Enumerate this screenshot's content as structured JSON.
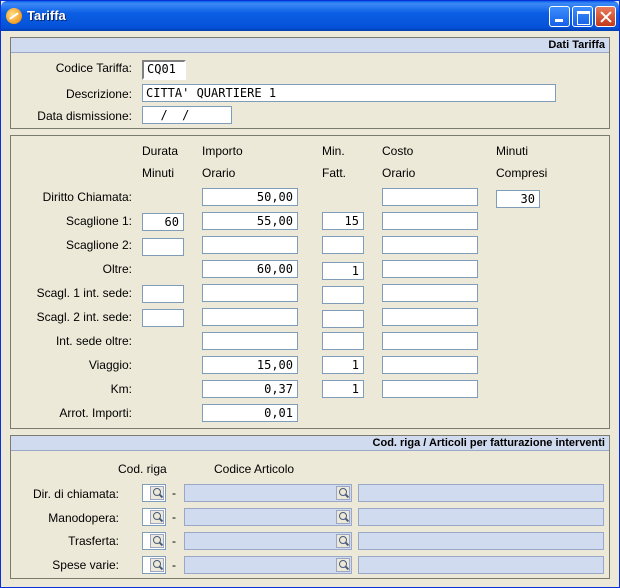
{
  "window": {
    "title": "Tariffa"
  },
  "dati_tariffa": {
    "header": "Dati Tariffa",
    "codice_label": "Codice Tariffa:",
    "codice_value": "CQ01",
    "descrizione_label": "Descrizione:",
    "descrizione_value": "CITTA' QUARTIERE 1",
    "data_label": "Data dismissione:",
    "data_value": "  /  /"
  },
  "grid": {
    "headers": {
      "durata": [
        "Durata",
        "Minuti"
      ],
      "importo": [
        "Importo",
        "Orario"
      ],
      "min": [
        "Min.",
        "Fatt."
      ],
      "costo": [
        "Costo",
        "Orario"
      ],
      "minuti": [
        "Minuti",
        "Compresi"
      ]
    },
    "rows": [
      {
        "label": "Diritto Chiamata:",
        "durata": null,
        "importo": "50,00",
        "min": null,
        "costo": "",
        "compresi": "30"
      },
      {
        "label": "Scaglione 1:",
        "durata": "60",
        "importo": "55,00",
        "min": "15",
        "costo": ""
      },
      {
        "label": "Scaglione 2:",
        "durata": "",
        "importo": "",
        "min": "",
        "costo": ""
      },
      {
        "label": "Oltre:",
        "durata": null,
        "importo": "60,00",
        "min": "1",
        "costo": ""
      },
      {
        "label": "Scagl. 1 int. sede:",
        "durata": "",
        "importo": "",
        "min": "",
        "costo": ""
      },
      {
        "label": "Scagl. 2 int. sede:",
        "durata": "",
        "importo": "",
        "min": "",
        "costo": ""
      },
      {
        "label": "Int. sede oltre:",
        "durata": null,
        "importo": "",
        "min": "",
        "costo": ""
      },
      {
        "label": "Viaggio:",
        "durata": null,
        "importo": "15,00",
        "min": "1",
        "costo": ""
      },
      {
        "label": "Km:",
        "durata": null,
        "importo": "0,37",
        "min": "1",
        "costo": ""
      },
      {
        "label": "Arrot. Importi:",
        "durata": null,
        "importo": "0,01",
        "min": null,
        "costo": null
      }
    ]
  },
  "articoli": {
    "header": "Cod. riga / Articoli per fatturazione interventi",
    "col_riga": "Cod. riga",
    "col_articolo": "Codice Articolo",
    "rows": [
      {
        "label": "Dir. di chiamata:"
      },
      {
        "label": "Manodopera:"
      },
      {
        "label": "Trasferta:"
      },
      {
        "label": "Spese varie:"
      }
    ],
    "separator": "-"
  }
}
